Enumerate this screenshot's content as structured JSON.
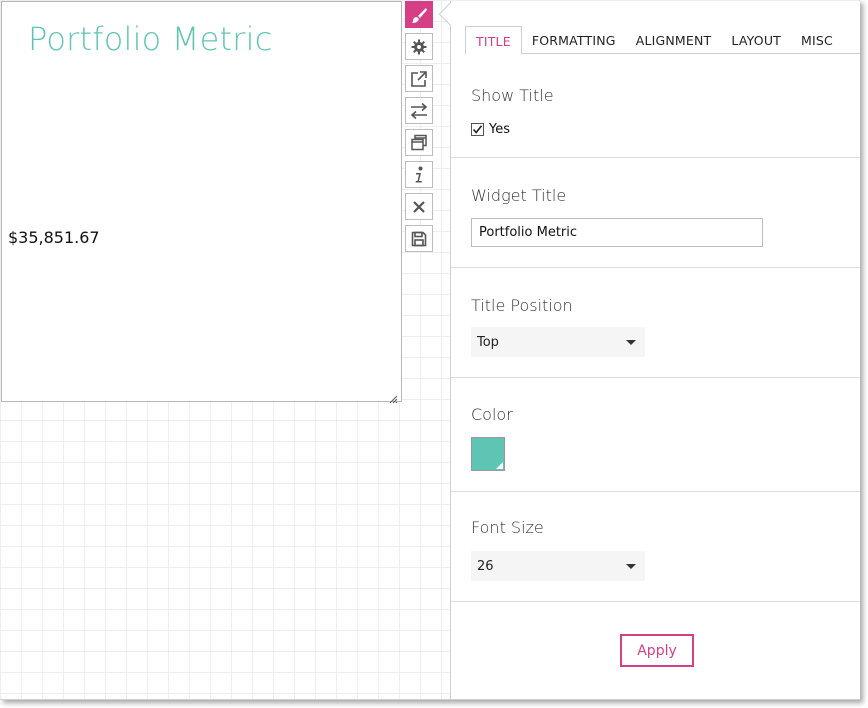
{
  "widget": {
    "title": "Portfolio Metric",
    "title_color": "#5ec5b5",
    "value": "$35,851.67"
  },
  "toolbar": {
    "buttons": [
      {
        "name": "paintbrush-icon",
        "active": true
      },
      {
        "name": "gear-icon",
        "active": false
      },
      {
        "name": "external-link-icon",
        "active": false
      },
      {
        "name": "swap-arrows-icon",
        "active": false
      },
      {
        "name": "duplicate-icon",
        "active": false
      },
      {
        "name": "info-icon",
        "active": false
      },
      {
        "name": "close-icon",
        "active": false
      },
      {
        "name": "save-icon",
        "active": false
      }
    ]
  },
  "panel": {
    "tabs": [
      {
        "label": "TITLE",
        "active": true
      },
      {
        "label": "FORMATTING",
        "active": false
      },
      {
        "label": "ALIGNMENT",
        "active": false
      },
      {
        "label": "LAYOUT",
        "active": false
      },
      {
        "label": "MISC",
        "active": false
      }
    ],
    "show_title": {
      "label": "Show Title",
      "checkbox_label": "Yes",
      "checked": true
    },
    "widget_title": {
      "label": "Widget Title",
      "value": "Portfolio Metric"
    },
    "title_position": {
      "label": "Title Position",
      "value": "Top"
    },
    "color": {
      "label": "Color",
      "value": "#5ec5b5"
    },
    "font_size": {
      "label": "Font Size",
      "value": "26"
    },
    "apply_label": "Apply"
  },
  "theme": {
    "accent": "#d63f86"
  }
}
